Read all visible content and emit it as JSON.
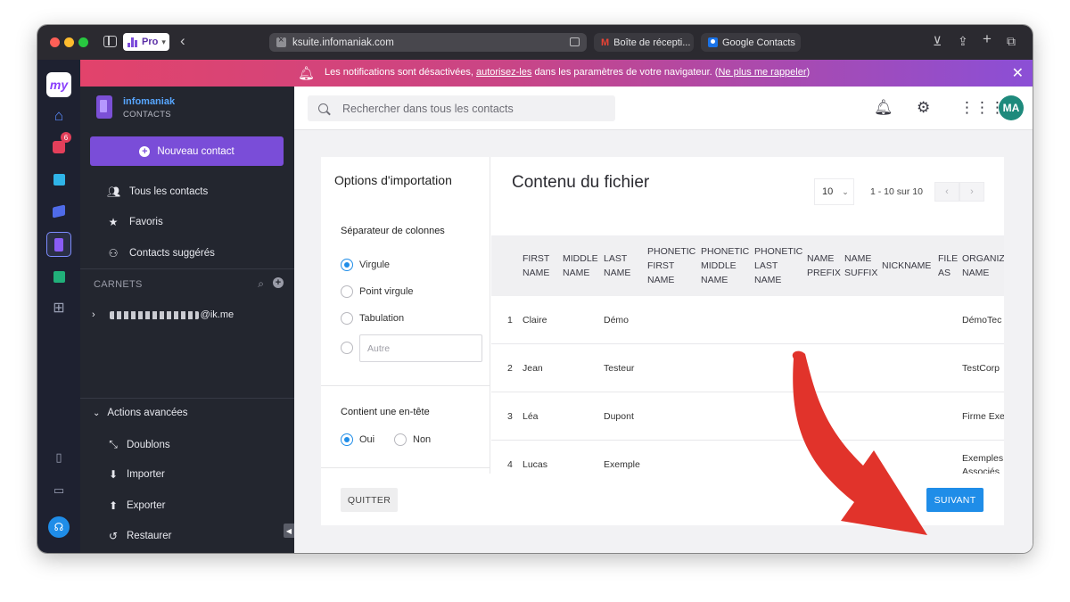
{
  "browser": {
    "profile_label": "Pro",
    "url": "ksuite.infomaniak.com",
    "tabs": [
      {
        "label": "Boîte de récepti..."
      },
      {
        "label": "Google Contacts"
      }
    ]
  },
  "rail": {
    "logo_text": "my",
    "mail_badge": "6"
  },
  "notification": {
    "text_before": "Les notifications sont désactivées, ",
    "link1": "autorisez-les",
    "text_middle": " dans les paramètres de votre navigateur. (",
    "link2": "Ne plus me rappeler",
    "text_after": ")"
  },
  "sidebar": {
    "brand_name": "infomaniak",
    "brand_sub": "CONTACTS",
    "new_contact": "Nouveau contact",
    "nav": [
      {
        "label": "Tous les contacts",
        "icon": "people-icon"
      },
      {
        "label": "Favoris",
        "icon": "star-icon"
      },
      {
        "label": "Contacts suggérés",
        "icon": "suggested-icon"
      }
    ],
    "carnets_label": "CARNETS",
    "account_suffix": "@ik.me",
    "advanced_title": "Actions avancées",
    "advanced": [
      {
        "label": "Doublons",
        "icon": "merge-icon"
      },
      {
        "label": "Importer",
        "icon": "import-icon"
      },
      {
        "label": "Exporter",
        "icon": "export-icon"
      },
      {
        "label": "Restaurer",
        "icon": "restore-icon"
      }
    ]
  },
  "topbar": {
    "search_placeholder": "Rechercher dans tous les contacts",
    "avatar_initials": "MA"
  },
  "options": {
    "title": "Options d'importation",
    "separator_title": "Séparateur de colonnes",
    "separators": [
      {
        "label": "Virgule",
        "selected": true
      },
      {
        "label": "Point virgule",
        "selected": false
      },
      {
        "label": "Tabulation",
        "selected": false
      }
    ],
    "other_placeholder": "Autre",
    "header_title": "Contient une en-tête",
    "header_yes": "Oui",
    "header_no": "Non"
  },
  "file_content": {
    "title": "Contenu du fichier",
    "per_page": "10",
    "range": "1 - 10 sur 10",
    "columns": [
      [
        "FIRST",
        "NAME"
      ],
      [
        "MIDDLE",
        "NAME"
      ],
      [
        "LAST",
        "NAME"
      ],
      [
        "PHONETIC",
        "FIRST",
        "NAME"
      ],
      [
        "PHONETIC",
        "MIDDLE",
        "NAME"
      ],
      [
        "PHONETIC",
        "LAST",
        "NAME"
      ],
      [
        "NAME",
        "PREFIX"
      ],
      [
        "NAME",
        "SUFFIX"
      ],
      [
        "NICKNAME"
      ],
      [
        "FILE",
        "AS"
      ],
      [
        "ORGANIZ",
        "NAME"
      ]
    ],
    "rows": [
      {
        "index": "1",
        "first": "Claire",
        "last": "Démo",
        "org": "DémoTec"
      },
      {
        "index": "2",
        "first": "Jean",
        "last": "Testeur",
        "org": "TestCorp"
      },
      {
        "index": "3",
        "first": "Léa",
        "last": "Dupont",
        "org": "Firme Exe"
      },
      {
        "index": "4",
        "first": "Lucas",
        "last": "Exemple",
        "org": "Exemples Associés"
      }
    ]
  },
  "footer": {
    "quit": "QUITTER",
    "next": "SUIVANT"
  },
  "colors": {
    "accent": "#1f8de8",
    "brand_purple": "#7a4dd8",
    "arrow": "#e1332b"
  }
}
